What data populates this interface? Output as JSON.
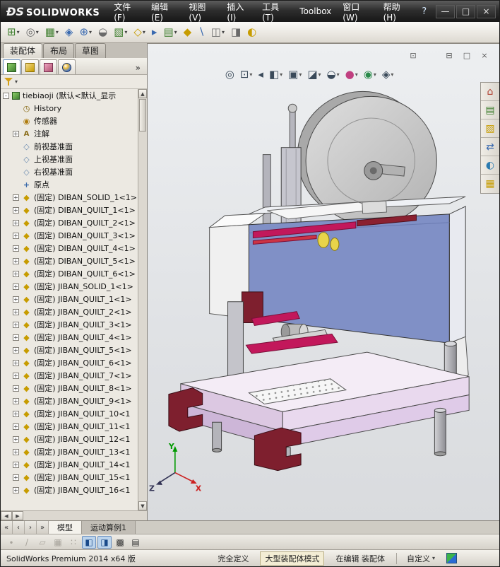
{
  "titlebar": {
    "logo_mark": "ĐS",
    "logo_text": "SOLIDWORKS",
    "help_label": "?",
    "menus": [
      {
        "name": "menu-file",
        "label": "文件(F)"
      },
      {
        "name": "menu-edit",
        "label": "编辑(E)"
      },
      {
        "name": "menu-view",
        "label": "视图(V)"
      },
      {
        "name": "menu-insert",
        "label": "插入(I)"
      },
      {
        "name": "menu-tools",
        "label": "工具(T)"
      },
      {
        "name": "menu-toolbox",
        "label": "Toolbox"
      },
      {
        "name": "menu-window",
        "label": "窗口(W)"
      },
      {
        "name": "menu-help",
        "label": "帮助(H)"
      }
    ],
    "window_buttons": [
      {
        "name": "minimize-button",
        "glyph": "—"
      },
      {
        "name": "maximize-button",
        "glyph": "□"
      },
      {
        "name": "close-button",
        "glyph": "×"
      }
    ]
  },
  "main_toolbar": {
    "buttons": [
      {
        "name": "insert-components-button",
        "glyph": "⊞",
        "color": "#3f7f2f",
        "dropdown": true
      },
      {
        "name": "mate-button",
        "glyph": "◎",
        "color": "#6a6a6a",
        "dropdown": true
      },
      {
        "name": "linear-component-pattern-button",
        "glyph": "▦",
        "color": "#3f7f2f",
        "dropdown": true
      },
      {
        "name": "smart-fasteners-button",
        "glyph": "◈",
        "color": "#3a6ab0",
        "dropdown": false
      },
      {
        "name": "move-component-button",
        "glyph": "⊕",
        "color": "#3a6ab0",
        "dropdown": true
      },
      {
        "name": "show-hidden-components-button",
        "glyph": "◒",
        "color": "#6a6a6a",
        "dropdown": false
      },
      {
        "name": "assembly-features-button",
        "glyph": "▧",
        "color": "#3f7f2f",
        "dropdown": true
      },
      {
        "name": "reference-geometry-button",
        "glyph": "◇",
        "color": "#c79c00",
        "dropdown": true
      },
      {
        "name": "new-motion-study-button",
        "glyph": "▸",
        "color": "#3a6ab0",
        "dropdown": false
      },
      {
        "name": "bill-of-materials-button",
        "glyph": "▤",
        "color": "#3f7f2f",
        "dropdown": true
      },
      {
        "name": "exploded-view-button",
        "glyph": "◆",
        "color": "#c79c00",
        "dropdown": false
      },
      {
        "name": "explode-line-sketch-button",
        "glyph": "∖",
        "color": "#3a6ab0",
        "dropdown": false
      },
      {
        "name": "interference-detection-button",
        "glyph": "◫",
        "color": "#6a6a6a",
        "dropdown": true
      },
      {
        "name": "clearance-verification-button",
        "glyph": "◨",
        "color": "#6a6a6a",
        "dropdown": false
      },
      {
        "name": "instant3d-button",
        "glyph": "◐",
        "color": "#c79c00",
        "dropdown": false
      }
    ]
  },
  "left_panel": {
    "tabs": [
      {
        "name": "tab-assembly",
        "label": "装配体",
        "active": true
      },
      {
        "name": "tab-layout",
        "label": "布局",
        "active": false
      },
      {
        "name": "tab-sketch",
        "label": "草图",
        "active": false
      }
    ],
    "manager_tabs": [
      {
        "name": "featuremanager-tab",
        "icon": "featuremanager-icon",
        "active": true
      },
      {
        "name": "propertymanager-tab",
        "icon": "propertymanager-icon",
        "active": false
      },
      {
        "name": "configurationmanager-tab",
        "icon": "configurationmanager-icon",
        "active": false
      },
      {
        "name": "displaymanager-tab",
        "icon": "displaymanager-icon",
        "active": false
      }
    ],
    "tree": {
      "root_expander": "-",
      "root_label": "tiebiaoji (默认<默认_显示",
      "items": [
        {
          "icon": "history-icon",
          "label": "History"
        },
        {
          "icon": "sensors-icon",
          "label": "传感器"
        },
        {
          "exp": "+",
          "icon": "annotations-icon",
          "label": "注解"
        },
        {
          "icon": "plane-icon",
          "label": "前视基准面"
        },
        {
          "icon": "plane-icon",
          "label": "上视基准面"
        },
        {
          "icon": "plane-icon",
          "label": "右视基准面"
        },
        {
          "icon": "origin-icon",
          "label": "原点"
        },
        {
          "exp": "+",
          "icon": "part-icon",
          "label": "(固定) DIBAN_SOLID_1<1>"
        },
        {
          "exp": "+",
          "icon": "part-icon",
          "label": "(固定) DIBAN_QUILT_1<1>"
        },
        {
          "exp": "+",
          "icon": "part-icon",
          "label": "(固定) DIBAN_QUILT_2<1>"
        },
        {
          "exp": "+",
          "icon": "part-icon",
          "label": "(固定) DIBAN_QUILT_3<1>"
        },
        {
          "exp": "+",
          "icon": "part-icon",
          "label": "(固定) DIBAN_QUILT_4<1>"
        },
        {
          "exp": "+",
          "icon": "part-icon",
          "label": "(固定) DIBAN_QUILT_5<1>"
        },
        {
          "exp": "+",
          "icon": "part-icon",
          "label": "(固定) DIBAN_QUILT_6<1>"
        },
        {
          "exp": "+",
          "icon": "part-icon",
          "label": "(固定) JIBAN_SOLID_1<1>"
        },
        {
          "exp": "+",
          "icon": "part-icon",
          "label": "(固定) JIBAN_QUILT_1<1>"
        },
        {
          "exp": "+",
          "icon": "part-icon",
          "label": "(固定) JIBAN_QUILT_2<1>"
        },
        {
          "exp": "+",
          "icon": "part-icon",
          "label": "(固定) JIBAN_QUILT_3<1>"
        },
        {
          "exp": "+",
          "icon": "part-icon",
          "label": "(固定) JIBAN_QUILT_4<1>"
        },
        {
          "exp": "+",
          "icon": "part-icon",
          "label": "(固定) JIBAN_QUILT_5<1>"
        },
        {
          "exp": "+",
          "icon": "part-icon",
          "label": "(固定) JIBAN_QUILT_6<1>"
        },
        {
          "exp": "+",
          "icon": "part-icon",
          "label": "(固定) JIBAN_QUILT_7<1>"
        },
        {
          "exp": "+",
          "icon": "part-icon",
          "label": "(固定) JIBAN_QUILT_8<1>"
        },
        {
          "exp": "+",
          "icon": "part-icon",
          "label": "(固定) JIBAN_QUILT_9<1>"
        },
        {
          "exp": "+",
          "icon": "part-icon",
          "label": "(固定) JIBAN_QUILT_10<1"
        },
        {
          "exp": "+",
          "icon": "part-icon",
          "label": "(固定) JIBAN_QUILT_11<1"
        },
        {
          "exp": "+",
          "icon": "part-icon",
          "label": "(固定) JIBAN_QUILT_12<1"
        },
        {
          "exp": "+",
          "icon": "part-icon",
          "label": "(固定) JIBAN_QUILT_13<1"
        },
        {
          "exp": "+",
          "icon": "part-icon",
          "label": "(固定) JIBAN_QUILT_14<1"
        },
        {
          "exp": "+",
          "icon": "part-icon",
          "label": "(固定) JIBAN_QUILT_15<1"
        },
        {
          "exp": "+",
          "icon": "part-icon",
          "label": "(固定) JIBAN_QUILT_16<1"
        }
      ]
    }
  },
  "viewport": {
    "child_controls": [
      {
        "name": "split-pane-button",
        "glyph": "⊡"
      },
      {
        "name": "pane-layout-button",
        "glyph": "⊟"
      },
      {
        "name": "restore-document-button",
        "glyph": "□"
      },
      {
        "name": "close-document-button",
        "glyph": "×"
      }
    ],
    "hud_buttons": [
      {
        "name": "zoom-to-fit-button",
        "glyph": "◎",
        "color": "#3a4a5a",
        "dropdown": false
      },
      {
        "name": "zoom-to-area-button",
        "glyph": "⊡",
        "color": "#3a4a5a",
        "dropdown": true
      },
      {
        "name": "previous-view-button",
        "glyph": "◂",
        "color": "#3a4a5a",
        "dropdown": false
      },
      {
        "name": "section-view-button",
        "glyph": "◧",
        "color": "#3a4a5a",
        "dropdown": true
      },
      {
        "name": "view-orientation-button",
        "glyph": "▣",
        "color": "#3a4a5a",
        "dropdown": true
      },
      {
        "name": "display-style-button",
        "glyph": "◪",
        "color": "#3a4a5a",
        "dropdown": true
      },
      {
        "name": "hide-show-items-button",
        "glyph": "◒",
        "color": "#3a4a5a",
        "dropdown": true
      },
      {
        "name": "edit-appearance-button",
        "glyph": "●",
        "color": "#c04080",
        "dropdown": true
      },
      {
        "name": "apply-scene-button",
        "glyph": "◉",
        "color": "#2a8a4a",
        "dropdown": true
      },
      {
        "name": "view-settings-button",
        "glyph": "◈",
        "color": "#3a4a5a",
        "dropdown": true
      }
    ],
    "task_pane_tabs": [
      {
        "name": "solidworks-resources-tab",
        "glyph": "⌂",
        "color": "#b04030"
      },
      {
        "name": "design-library-tab",
        "glyph": "▤",
        "color": "#3f7f2f"
      },
      {
        "name": "file-explorer-tab",
        "glyph": "▨",
        "color": "#c79c00"
      },
      {
        "name": "view-palette-tab",
        "glyph": "⇄",
        "color": "#3a6ab0"
      },
      {
        "name": "appearances-scenes-tab",
        "glyph": "◐",
        "color": "#2a7ab0"
      },
      {
        "name": "custom-properties-tab",
        "glyph": "▦",
        "color": "#c79c00"
      }
    ],
    "triad": {
      "x_label": "X",
      "y_label": "Y",
      "z_label": "Z",
      "x_color": "#cc2020",
      "y_color": "#009900",
      "z_color": "#333355"
    }
  },
  "bottom": {
    "nav_buttons": [
      {
        "name": "first-tab-button",
        "glyph": "«"
      },
      {
        "name": "previous-tab-button",
        "glyph": "‹"
      },
      {
        "name": "next-tab-button",
        "glyph": "›"
      },
      {
        "name": "last-tab-button",
        "glyph": "»"
      }
    ],
    "view_tabs": [
      {
        "name": "tab-model",
        "label": "模型",
        "active": true
      },
      {
        "name": "tab-motion-study-1",
        "label": "运动算例1",
        "active": false
      }
    ],
    "quick_buttons": [
      {
        "name": "filter-vertices-button",
        "glyph": "∙",
        "disabled": true
      },
      {
        "name": "filter-edges-button",
        "glyph": "/",
        "disabled": true
      },
      {
        "name": "filter-faces-button",
        "glyph": "▱",
        "disabled": true
      },
      {
        "name": "toggle-selection-filters-button",
        "glyph": "▦",
        "disabled": true
      },
      {
        "name": "snap-options-button",
        "glyph": "∷",
        "disabled": true
      },
      {
        "name": "front-view-button",
        "glyph": "◧",
        "pressed": true
      },
      {
        "name": "isometric-view-button",
        "glyph": "◨",
        "pressed": true
      },
      {
        "name": "shaded-display-button",
        "glyph": "▩"
      },
      {
        "name": "grid-display-button",
        "glyph": "▤"
      }
    ]
  },
  "status_bar": {
    "product": "SolidWorks Premium 2014 x64 版",
    "definition": "完全定义",
    "mode": "大型装配体模式",
    "editing": "在编辑 装配体",
    "customize": "自定义"
  }
}
